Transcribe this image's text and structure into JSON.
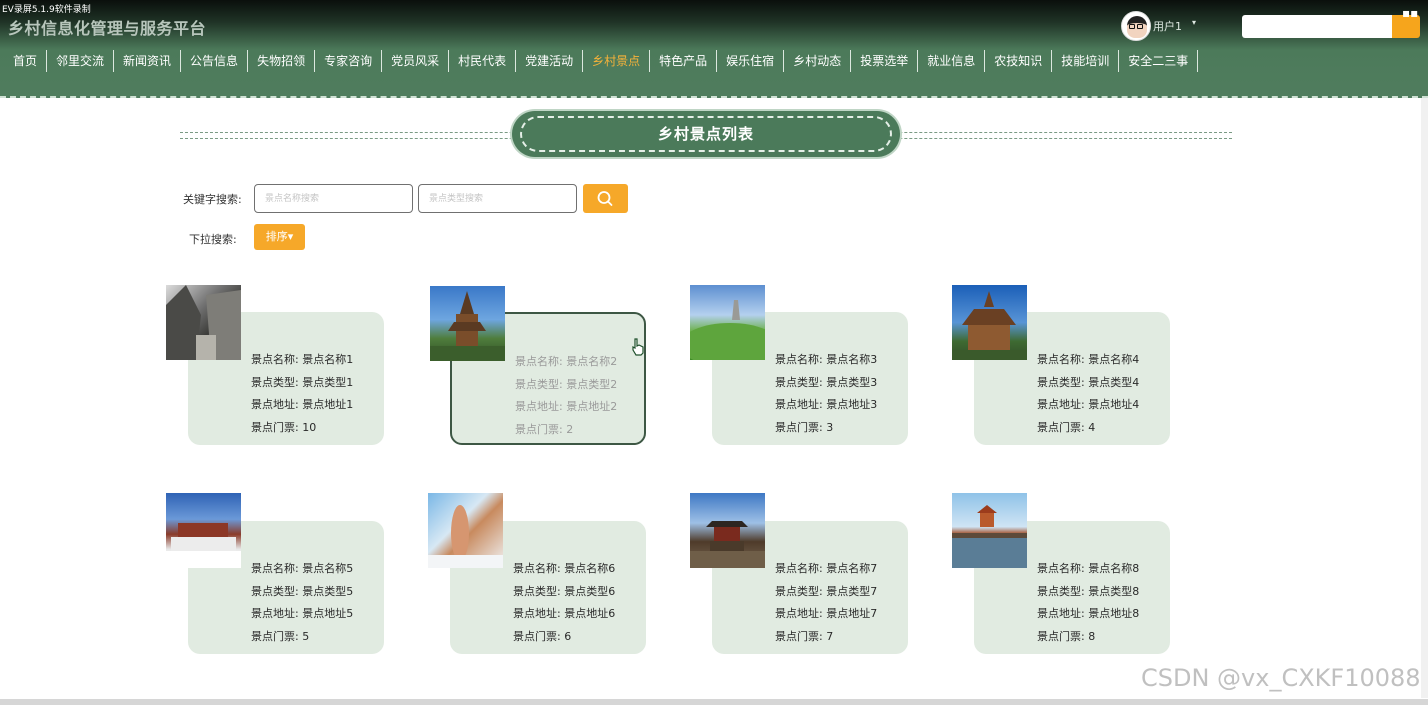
{
  "recorder": {
    "label": "EV录屏5.1.9软件录制"
  },
  "site": {
    "title": "乡村信息化管理与服务平台"
  },
  "user": {
    "name": "用户1",
    "caret": "▾"
  },
  "window": {
    "icon": "▪▪"
  },
  "nav": {
    "items": [
      {
        "label": "首页"
      },
      {
        "label": "邻里交流"
      },
      {
        "label": "新闻资讯"
      },
      {
        "label": "公告信息"
      },
      {
        "label": "失物招领"
      },
      {
        "label": "专家咨询"
      },
      {
        "label": "党员风采"
      },
      {
        "label": "村民代表"
      },
      {
        "label": "党建活动"
      },
      {
        "label": "乡村景点"
      },
      {
        "label": "特色产品"
      },
      {
        "label": "娱乐住宿"
      },
      {
        "label": "乡村动态"
      },
      {
        "label": "投票选举"
      },
      {
        "label": "就业信息"
      },
      {
        "label": "农技知识"
      },
      {
        "label": "技能培训"
      },
      {
        "label": "安全二三事"
      }
    ],
    "active_index": 9
  },
  "page": {
    "heading": "乡村景点列表"
  },
  "search": {
    "keyword_label": "关键字搜索:",
    "name_placeholder": "景点名称搜索",
    "type_placeholder": "景点类型搜索",
    "dropdown_label": "下拉搜索:",
    "sort_label": "排序▾"
  },
  "spots": [
    {
      "name_line": "景点名称: 景点名称1",
      "type_line": "景点类型: 景点类型1",
      "addr_line": "景点地址: 景点地址1",
      "ticket_line": "景点门票: 10"
    },
    {
      "name_line": "景点名称: 景点名称2",
      "type_line": "景点类型: 景点类型2",
      "addr_line": "景点地址: 景点地址2",
      "ticket_line": "景点门票: 2"
    },
    {
      "name_line": "景点名称: 景点名称3",
      "type_line": "景点类型: 景点类型3",
      "addr_line": "景点地址: 景点地址3",
      "ticket_line": "景点门票: 3"
    },
    {
      "name_line": "景点名称: 景点名称4",
      "type_line": "景点类型: 景点类型4",
      "addr_line": "景点地址: 景点地址4",
      "ticket_line": "景点门票: 4"
    },
    {
      "name_line": "景点名称: 景点名称5",
      "type_line": "景点类型: 景点类型5",
      "addr_line": "景点地址: 景点地址5",
      "ticket_line": "景点门票: 5"
    },
    {
      "name_line": "景点名称: 景点名称6",
      "type_line": "景点类型: 景点类型6",
      "addr_line": "景点地址: 景点地址6",
      "ticket_line": "景点门票: 6"
    },
    {
      "name_line": "景点名称: 景点名称7",
      "type_line": "景点类型: 景点类型7",
      "addr_line": "景点地址: 景点地址7",
      "ticket_line": "景点门票: 7"
    },
    {
      "name_line": "景点名称: 景点名称8",
      "type_line": "景点类型: 景点类型8",
      "addr_line": "景点地址: 景点地址8",
      "ticket_line": "景点门票: 8"
    }
  ],
  "watermark": "CSDN @vx_CXKF10088",
  "colors": {
    "nav_bg": "#507d5e",
    "accent": "#f6a829",
    "card_bg": "#e1ebe1",
    "active_nav": "#f6b23a"
  }
}
